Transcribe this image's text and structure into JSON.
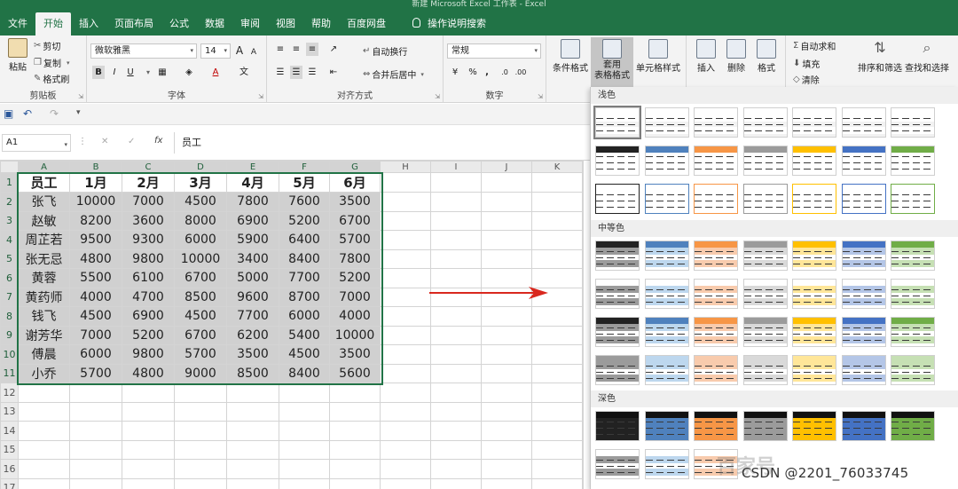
{
  "window": {
    "title": "新建 Microsoft Excel 工作表 - Excel"
  },
  "tabs": [
    {
      "label": "文件"
    },
    {
      "label": "开始",
      "active": true
    },
    {
      "label": "插入"
    },
    {
      "label": "页面布局"
    },
    {
      "label": "公式"
    },
    {
      "label": "数据"
    },
    {
      "label": "审阅"
    },
    {
      "label": "视图"
    },
    {
      "label": "帮助"
    },
    {
      "label": "百度网盘"
    },
    {
      "label": "操作说明搜索"
    }
  ],
  "ribbon": {
    "clipboard": {
      "paste": "粘贴",
      "cut": "剪切",
      "copy": "复制",
      "format_painter": "格式刷",
      "label": "剪贴板"
    },
    "font": {
      "name": "微软雅黑",
      "size": "14",
      "bold": "B",
      "italic": "I",
      "underline": "U",
      "grow": "A",
      "shrink": "A",
      "font_color": "A",
      "phonetic": "文",
      "label": "字体"
    },
    "alignment": {
      "wrap": "自动换行",
      "merge": "合并后居中",
      "label": "对齐方式"
    },
    "number": {
      "format": "常规",
      "percent": "%",
      "comma": ",",
      "label": "数字"
    },
    "styles": {
      "conditional": "条件格式",
      "format_as_table": "套用\n表格格式",
      "cell_styles": "单元格样式"
    },
    "cells": {
      "insert": "插入",
      "delete": "删除",
      "format": "格式"
    },
    "editing": {
      "autosum": "自动求和",
      "fill": "填充",
      "clear": "清除",
      "sort_filter": "排序和筛选",
      "find_select": "查找和选择"
    }
  },
  "formula_bar": {
    "name_box": "A1",
    "fx": "fx",
    "value": "员工"
  },
  "sheet": {
    "columns": [
      "A",
      "B",
      "C",
      "D",
      "E",
      "F",
      "G",
      "H",
      "I",
      "J",
      "K"
    ],
    "rows": [
      [
        "员工",
        "1月",
        "2月",
        "3月",
        "4月",
        "5月",
        "6月"
      ],
      [
        "张飞",
        "10000",
        "7000",
        "4500",
        "7800",
        "7600",
        "3500"
      ],
      [
        "赵敏",
        "8200",
        "3600",
        "8000",
        "6900",
        "5200",
        "6700"
      ],
      [
        "周芷若",
        "9500",
        "9300",
        "6000",
        "5900",
        "6400",
        "5700"
      ],
      [
        "张无忌",
        "4800",
        "9800",
        "10000",
        "3400",
        "8400",
        "7800"
      ],
      [
        "黄蓉",
        "5500",
        "6100",
        "6700",
        "5000",
        "7700",
        "5200"
      ],
      [
        "黄药师",
        "4000",
        "4700",
        "8500",
        "9600",
        "8700",
        "7000"
      ],
      [
        "钱飞",
        "4500",
        "6900",
        "4500",
        "7700",
        "6000",
        "4000"
      ],
      [
        "谢芳华",
        "7000",
        "5200",
        "6700",
        "6200",
        "5400",
        "10000"
      ],
      [
        "傅晨",
        "6000",
        "9800",
        "5700",
        "3500",
        "4500",
        "3500"
      ],
      [
        "小乔",
        "5700",
        "4800",
        "9000",
        "8500",
        "8400",
        "5600"
      ]
    ],
    "row_numbers": [
      "1",
      "2",
      "3",
      "4",
      "5",
      "6",
      "7",
      "8",
      "9",
      "10",
      "11",
      "12",
      "13",
      "14",
      "15",
      "16",
      "17"
    ]
  },
  "gallery": {
    "sections": [
      {
        "title": "浅色"
      },
      {
        "title": "中等色"
      },
      {
        "title": "深色"
      }
    ],
    "palette": [
      "#222222",
      "#4f81bd",
      "#f79646",
      "#9b9b9b",
      "#ffc000",
      "#4472c4",
      "#70ad47"
    ],
    "light_palette": [
      "#9b9b9b",
      "#bdd7ee",
      "#f8cbad",
      "#d9d9d9",
      "#ffe699",
      "#b4c6e7",
      "#c6e0b4"
    ]
  },
  "watermark": "百家号",
  "credit": "CSDN @2201_76033745"
}
